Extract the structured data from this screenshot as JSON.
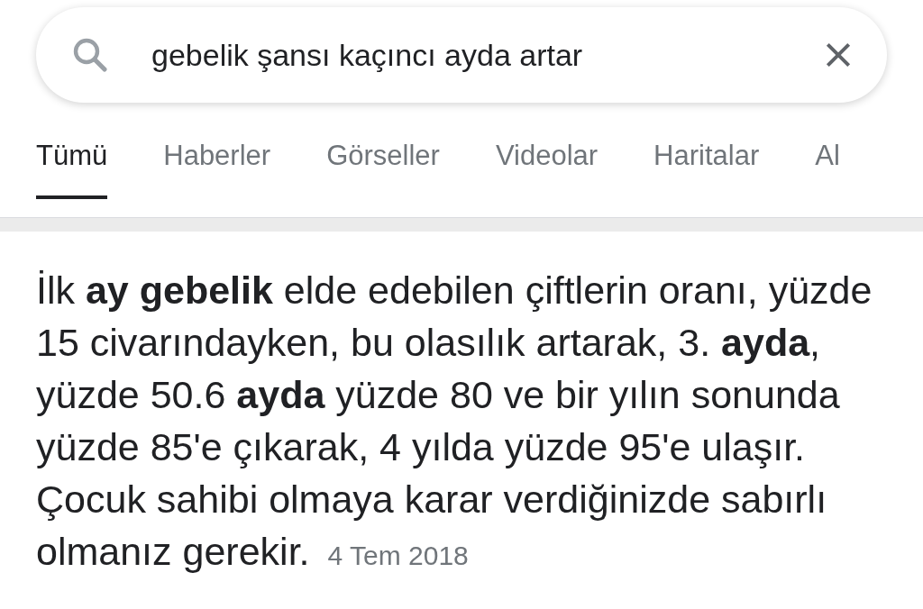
{
  "search": {
    "value": "gebelik şansı kaçıncı ayda artar"
  },
  "tabs": [
    {
      "label": "Tümü",
      "selected": true
    },
    {
      "label": "Haberler",
      "selected": false
    },
    {
      "label": "Görseller",
      "selected": false
    },
    {
      "label": "Videolar",
      "selected": false
    },
    {
      "label": "Haritalar",
      "selected": false
    },
    {
      "label": "Al",
      "selected": false
    }
  ],
  "snippet": {
    "text": "İlk **ay gebelik** elde edebilen çiftlerin oranı, yüzde 15 civarındayken, bu olasılık artarak, 3. **ayda**, yüzde 50.6 **ayda** yüzde 80 ve bir yılın sonunda yüzde 85'e çıkarak, 4 yılda yüzde 95'e ulaşır. Çocuk sahibi olmaya karar verdiğinizde sabırlı olmanız gerekir.",
    "date": "4 Tem 2018"
  }
}
